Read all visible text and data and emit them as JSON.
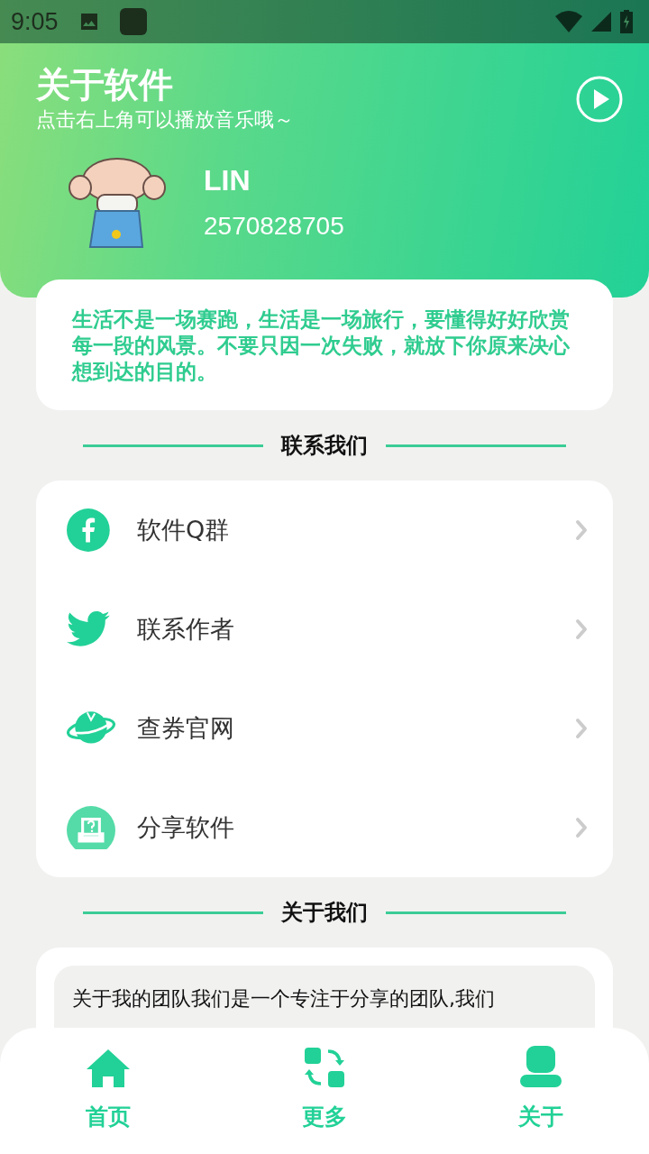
{
  "status_bar": {
    "time": "9:05"
  },
  "header": {
    "title": "关于软件",
    "subtitle": "点击右上角可以播放音乐哦～",
    "user": {
      "name": "LIN",
      "id": "2570828705"
    }
  },
  "quote": "生活不是一场赛跑，生活是一场旅行，要懂得好好欣赏每一段的风景。不要只因一次失败，就放下你原来决心想到达的目的。",
  "contact": {
    "title": "联系我们",
    "items": [
      {
        "kind": "facebook",
        "label": "软件Q群"
      },
      {
        "kind": "bird",
        "label": "联系作者"
      },
      {
        "kind": "planet",
        "label": "查券官网"
      },
      {
        "kind": "share",
        "label": "分享软件"
      }
    ]
  },
  "about": {
    "title": "关于我们",
    "text": "关于我的团队我们是一个专注于分享的团队,我们"
  },
  "nav": [
    {
      "kind": "home",
      "label": "首页"
    },
    {
      "kind": "more",
      "label": "更多"
    },
    {
      "kind": "user",
      "label": "关于"
    }
  ]
}
